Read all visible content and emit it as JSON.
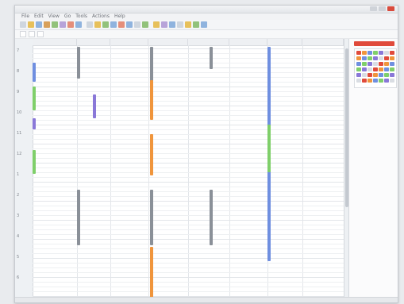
{
  "window": {
    "title": ""
  },
  "menu": [
    "File",
    "Edit",
    "View",
    "Go",
    "Tools",
    "Actions",
    "Help"
  ],
  "toolbar_colors": [
    "#cfd6df",
    "#e7c05a",
    "#8fb3de",
    "#d8a05a",
    "#92c27b",
    "#b7a3d9",
    "#e48e7a",
    "#8fb3de",
    "#cfd6df",
    "#e7c05a",
    "#92c27b",
    "#8fb3de",
    "#e48e7a",
    "#8fb3de",
    "#cfd6df",
    "#92c27b",
    "#e7c05a",
    "#b7a3d9",
    "#8fb3de",
    "#cfd6df",
    "#e7c05a",
    "#92c27b",
    "#8fb3de"
  ],
  "toolbar2": {
    "field1": "",
    "field2": "",
    "field3": ""
  },
  "columns": [
    "",
    "",
    "",
    "",
    "",
    "",
    ""
  ],
  "time_labels": [
    "7",
    "8",
    "9",
    "10",
    "11",
    "12",
    "1",
    "2",
    "3",
    "4",
    "5",
    "6"
  ],
  "colors": {
    "grey": "#8a9098",
    "orange": "#f0953c",
    "blue": "#6f8fe0",
    "green": "#7fcf6a",
    "purple": "#8a78d8",
    "accent_red": "#e04a3b"
  },
  "events": [
    {
      "label": "",
      "sub": ""
    },
    {
      "label": "",
      "sub": ""
    },
    {
      "label": "",
      "sub": ""
    },
    {
      "label": "",
      "sub": ""
    },
    {
      "label": "",
      "sub": ""
    },
    {
      "label": "",
      "sub": ""
    },
    {
      "label": "",
      "sub": ""
    },
    {
      "label": "",
      "sub": ""
    },
    {
      "label": "",
      "sub": ""
    },
    {
      "label": "",
      "sub": ""
    },
    {
      "label": "",
      "sub": ""
    },
    {
      "label": "",
      "sub": ""
    },
    {
      "label": "",
      "sub": ""
    },
    {
      "label": "",
      "sub": ""
    }
  ],
  "right_panel": {
    "title": ""
  },
  "status": {
    "left": "",
    "right": ""
  }
}
